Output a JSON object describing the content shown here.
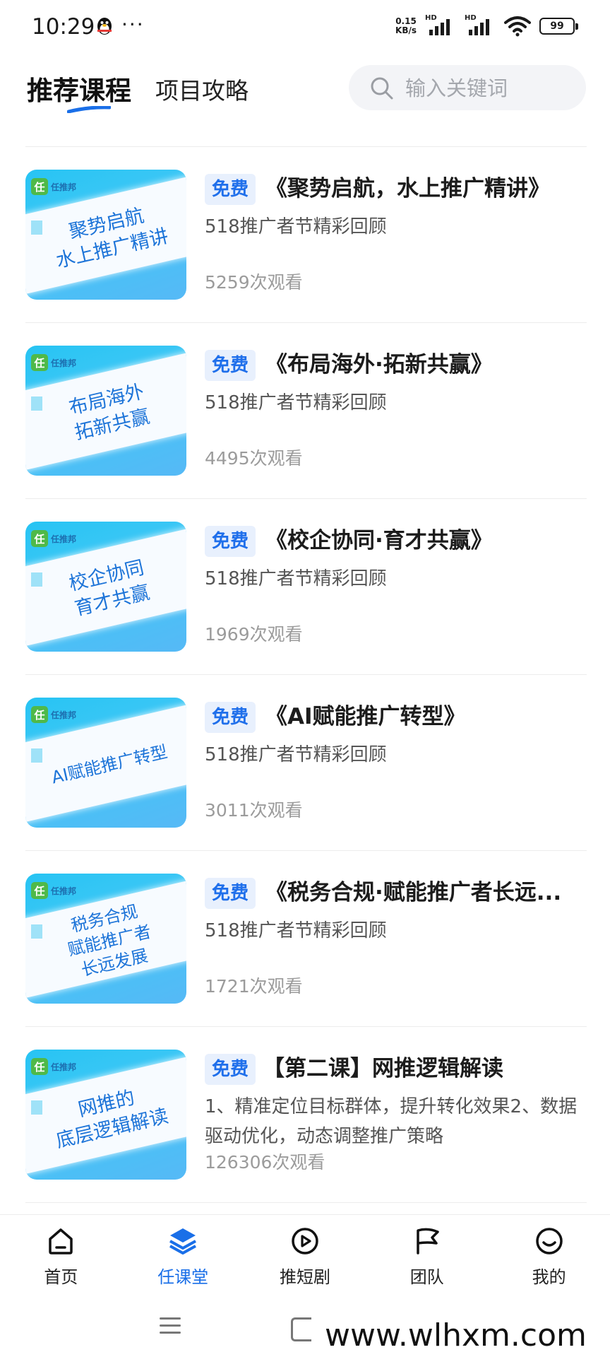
{
  "status": {
    "time": "10:29",
    "more": "···",
    "net_speed_top": "0.15",
    "net_speed_bottom": "KB/s",
    "sim1_label": "HD",
    "sim2_label": "HD",
    "battery": "99"
  },
  "header": {
    "tab_active": "推荐课程",
    "tab_other": "项目攻略",
    "search_placeholder": "输入关键词"
  },
  "courses": [
    {
      "badge": "免费",
      "title": "《聚势启航，水上推广精讲》",
      "subtitle": "518推广者节精彩回顾",
      "views": "5259次观看",
      "thumb_lines": [
        "聚势启航",
        "水上推广精讲"
      ]
    },
    {
      "badge": "免费",
      "title": "《布局海外·拓新共赢》",
      "subtitle": "518推广者节精彩回顾",
      "views": "4495次观看",
      "thumb_lines": [
        "布局海外",
        "拓新共赢"
      ]
    },
    {
      "badge": "免费",
      "title": "《校企协同·育才共赢》",
      "subtitle": "518推广者节精彩回顾",
      "views": "1969次观看",
      "thumb_lines": [
        "校企协同",
        "育才共赢"
      ]
    },
    {
      "badge": "免费",
      "title": "《AI赋能推广转型》",
      "subtitle": "518推广者节精彩回顾",
      "views": "3011次观看",
      "thumb_lines": [
        "AI赋能推广转型"
      ]
    },
    {
      "badge": "免费",
      "title": "《税务合规·赋能推广者长远...",
      "subtitle": "518推广者节精彩回顾",
      "views": "1721次观看",
      "thumb_lines": [
        "税务合规",
        "赋能推广者",
        "长远发展"
      ]
    },
    {
      "badge": "免费",
      "title": "【第二课】网推逻辑解读",
      "subtitle": "1、精准定位目标群体，提升转化效果2、数据驱动优化，动态调整推广策略",
      "views": "126306次观看",
      "thumb_lines": [
        "网推的",
        "底层逻辑解读"
      ]
    }
  ],
  "thumb_logo": {
    "mark": "任",
    "text": "任推邦"
  },
  "nav": {
    "items": [
      {
        "label": "首页",
        "icon": "home-icon"
      },
      {
        "label": "任课堂",
        "icon": "layers-icon"
      },
      {
        "label": "推短剧",
        "icon": "play-icon"
      },
      {
        "label": "团队",
        "icon": "flag-icon"
      },
      {
        "label": "我的",
        "icon": "smile-icon"
      }
    ],
    "active_index": 1
  },
  "watermark": "www.wlhxm.com",
  "colors": {
    "accent": "#1a6fe8",
    "badge_bg": "#e8f0fd",
    "thumb_blue": "#27c4f3"
  }
}
